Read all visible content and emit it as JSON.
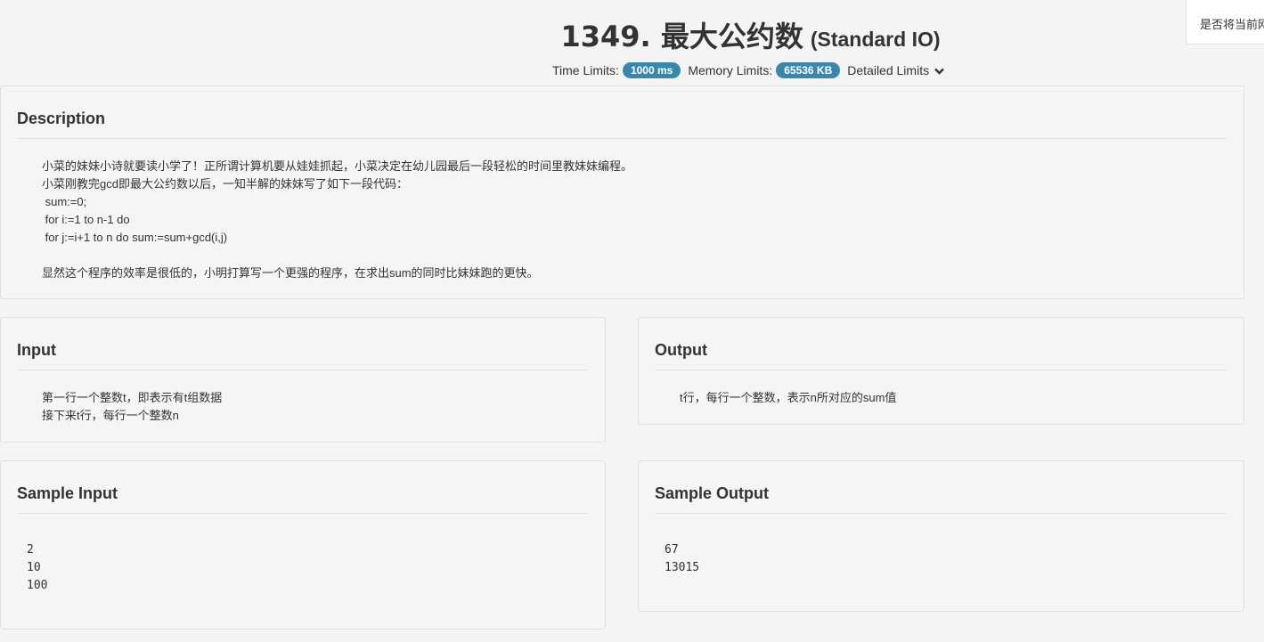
{
  "header": {
    "title": "1349. 最大公约数",
    "subtitle": "(Standard IO)",
    "time_label": "Time Limits:",
    "time_value": "1000 ms",
    "memory_label": "Memory Limits:",
    "memory_value": "65536 KB",
    "detailed_label": "Detailed Limits",
    "chevron_icon": "chevron-down-icon"
  },
  "notice": "是否将当前网",
  "description": {
    "title": "Description",
    "body": "小菜的妹妹小诗就要读小学了！正所谓计算机要从娃娃抓起，小菜决定在幼儿园最后一段轻松的时间里教妹妹编程。\n小菜刚教完gcd即最大公约数以后，一知半解的妹妹写了如下一段代码：\n sum:=0;\n for i:=1 to n-1 do\n for j:=i+1 to n do sum:=sum+gcd(i,j)\n\n显然这个程序的效率是很低的，小明打算写一个更强的程序，在求出sum的同时比妹妹跑的更快。"
  },
  "input": {
    "title": "Input",
    "body": "第一行一个整数t，即表示有t组数据\n接下来t行，每行一个整数n"
  },
  "output": {
    "title": "Output",
    "body": "t行，每行一个整数，表示n所对应的sum值"
  },
  "sample_input": {
    "title": "Sample Input",
    "body": "2\n10\n100"
  },
  "sample_output": {
    "title": "Sample Output",
    "body": "67\n13015"
  }
}
